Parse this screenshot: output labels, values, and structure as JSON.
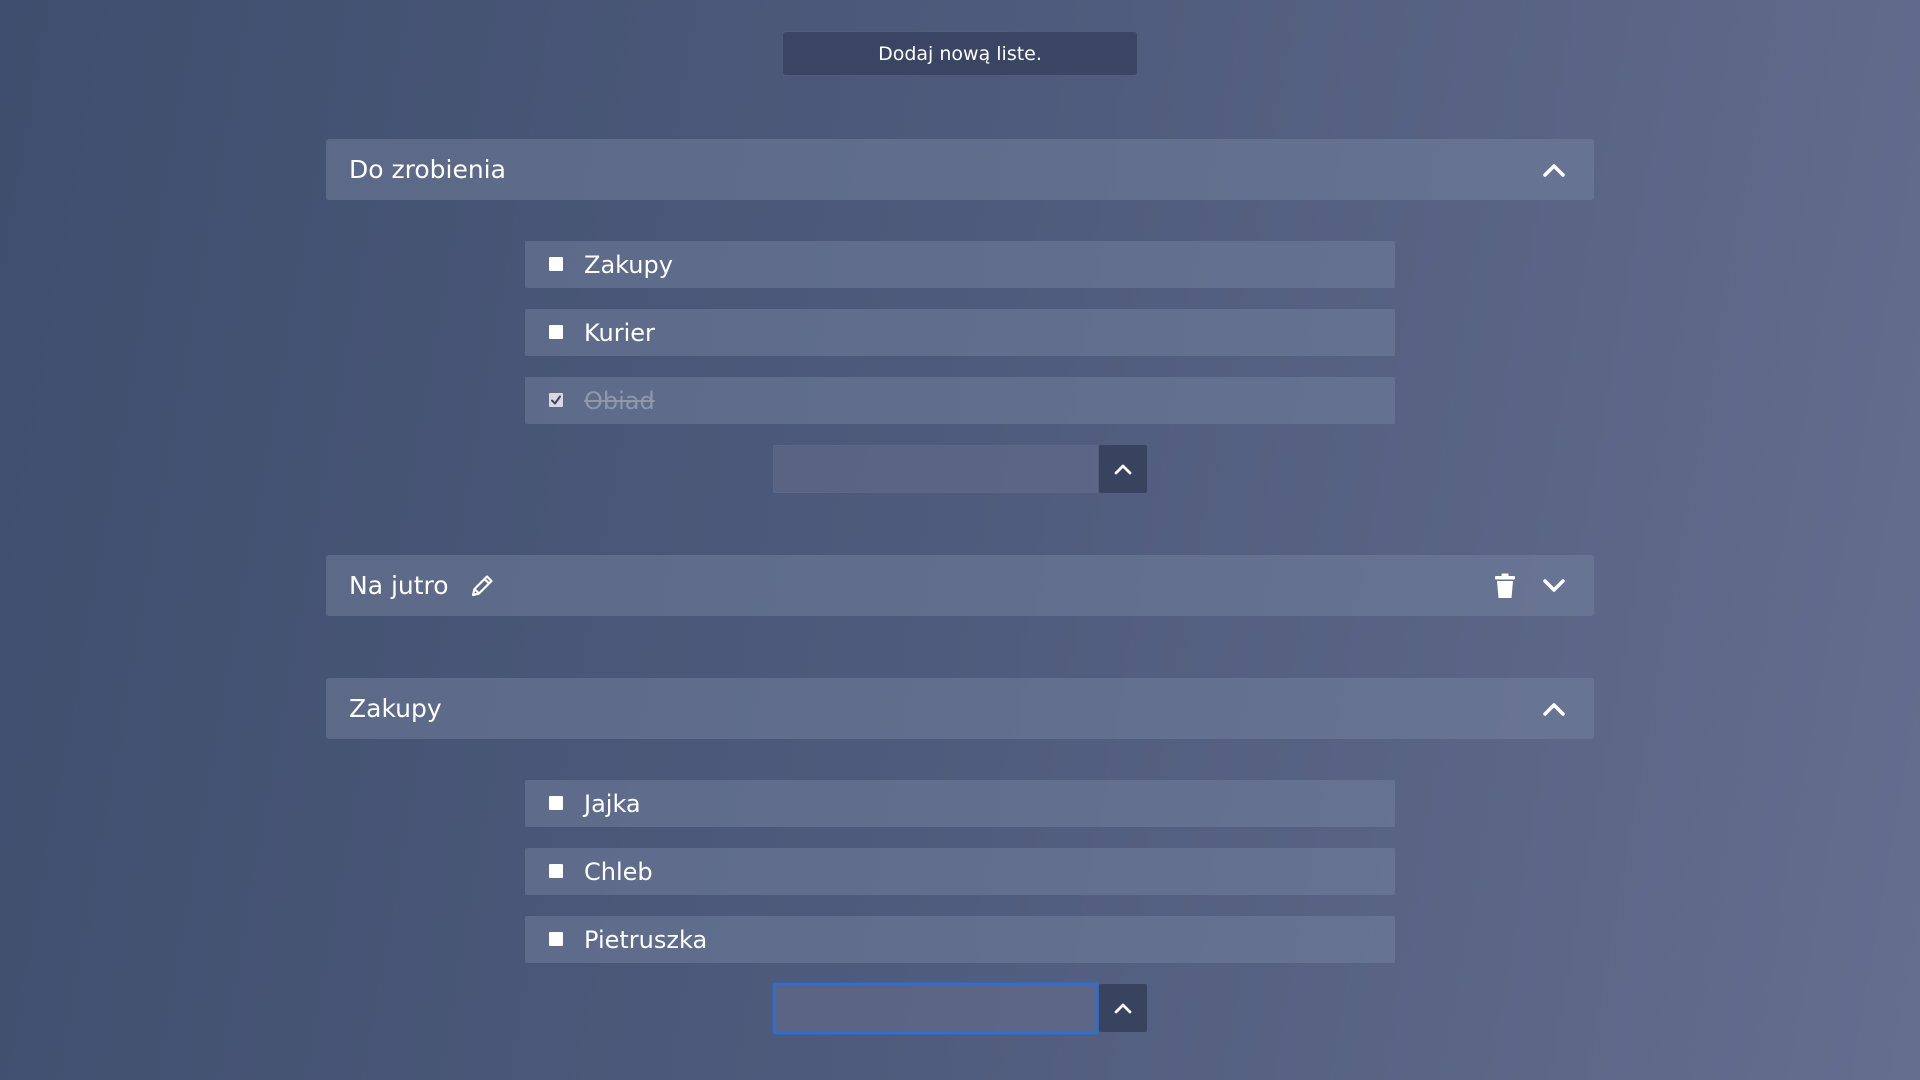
{
  "toolbar": {
    "add_list_label": "Dodaj nową liste."
  },
  "lists": [
    {
      "title": "Do zrobienia",
      "expanded": true,
      "tasks": [
        {
          "label": "Zakupy",
          "done": false
        },
        {
          "label": "Kurier",
          "done": false
        },
        {
          "label": "Obiad",
          "done": true
        }
      ],
      "new_task_value": ""
    },
    {
      "title": "Na jutro",
      "expanded": false,
      "icons": [
        "pencil-icon",
        "trash-icon",
        "chevron-down-icon"
      ]
    },
    {
      "title": "Zakupy",
      "expanded": true,
      "tasks": [
        {
          "label": "Jajka",
          "done": false
        },
        {
          "label": "Chleb",
          "done": false
        },
        {
          "label": "Pietruszka",
          "done": false
        }
      ],
      "new_task_value": ""
    }
  ],
  "colors": {
    "focus_outline": "#2d6fd6",
    "done_text": "#8f97ab"
  }
}
